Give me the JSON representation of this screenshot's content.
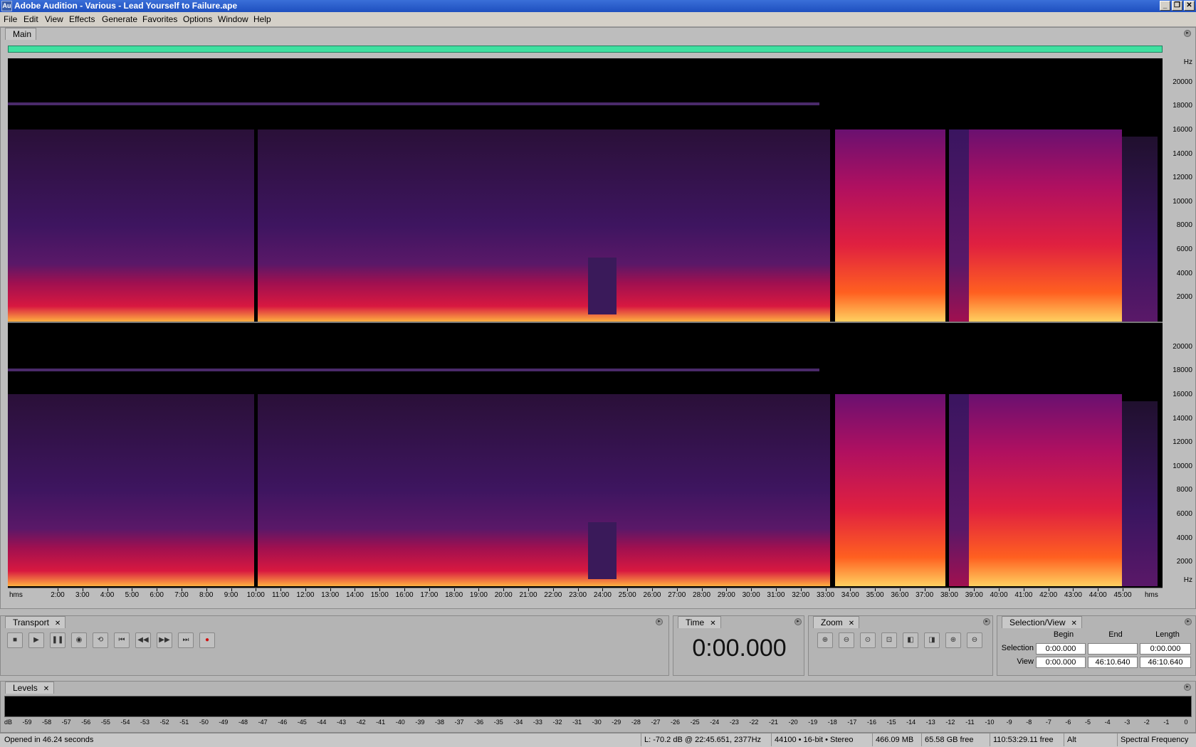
{
  "window": {
    "title": "Adobe Audition - Various - Lead Yourself to Failure.ape",
    "app_icon": "Au"
  },
  "menu": [
    "File",
    "Edit",
    "View",
    "Effects",
    "Generate",
    "Favorites",
    "Options",
    "Window",
    "Help"
  ],
  "main": {
    "tab": "Main",
    "hz_unit": "Hz",
    "hz_ticks": [
      "20000",
      "18000",
      "16000",
      "14000",
      "12000",
      "10000",
      "8000",
      "6000",
      "4000",
      "2000"
    ],
    "time_unit": "hms",
    "time_ticks": [
      "2:00",
      "3:00",
      "4:00",
      "5:00",
      "6:00",
      "7:00",
      "8:00",
      "9:00",
      "10:00",
      "11:00",
      "12:00",
      "13:00",
      "14:00",
      "15:00",
      "16:00",
      "17:00",
      "18:00",
      "19:00",
      "20:00",
      "21:00",
      "22:00",
      "23:00",
      "24:00",
      "25:00",
      "26:00",
      "27:00",
      "28:00",
      "29:00",
      "30:00",
      "31:00",
      "32:00",
      "33:00",
      "34:00",
      "35:00",
      "36:00",
      "37:00",
      "38:00",
      "39:00",
      "40:00",
      "41:00",
      "42:00",
      "43:00",
      "44:00",
      "45:00"
    ]
  },
  "transport": {
    "tab": "Transport",
    "buttons": [
      "stop-icon",
      "play-icon",
      "pause-icon",
      "play-from-cursor-icon",
      "loop-icon",
      "go-to-start-icon",
      "rewind-icon",
      "fast-forward-icon",
      "go-to-end-icon",
      "record-icon"
    ]
  },
  "time": {
    "tab": "Time",
    "value": "0:00.000"
  },
  "zoom": {
    "tab": "Zoom",
    "tools": [
      "zoom-in-horizontal-icon",
      "zoom-out-horizontal-icon",
      "zoom-full-icon",
      "zoom-selection-icon",
      "zoom-left-edge-icon",
      "zoom-right-edge-icon",
      "zoom-in-vertical-icon",
      "zoom-out-vertical-icon"
    ]
  },
  "selection_view": {
    "tab": "Selection/View",
    "headers": [
      "Begin",
      "End",
      "Length"
    ],
    "rows": [
      {
        "label": "Selection",
        "begin": "0:00.000",
        "end": "",
        "length": "0:00.000"
      },
      {
        "label": "View",
        "begin": "0:00.000",
        "end": "46:10.640",
        "length": "46:10.640"
      }
    ]
  },
  "levels": {
    "tab": "Levels",
    "unit": "dB",
    "ticks": [
      "-59",
      "-58",
      "-57",
      "-56",
      "-55",
      "-54",
      "-53",
      "-52",
      "-51",
      "-50",
      "-49",
      "-48",
      "-47",
      "-46",
      "-45",
      "-44",
      "-43",
      "-42",
      "-41",
      "-40",
      "-39",
      "-38",
      "-37",
      "-36",
      "-35",
      "-34",
      "-33",
      "-32",
      "-31",
      "-30",
      "-29",
      "-28",
      "-27",
      "-26",
      "-25",
      "-24",
      "-23",
      "-22",
      "-21",
      "-20",
      "-19",
      "-18",
      "-17",
      "-16",
      "-15",
      "-14",
      "-13",
      "-12",
      "-11",
      "-10",
      "-9",
      "-8",
      "-7",
      "-6",
      "-5",
      "-4",
      "-3",
      "-2",
      "-1",
      "0"
    ]
  },
  "status": {
    "message": "Opened in 46.24 seconds",
    "cursor": "L: -70.2 dB @  22:45.651, 2377Hz",
    "format": "44100 • 16-bit • Stereo",
    "size": "466.09 MB",
    "free": "65.58 GB free",
    "time_free": "110:53:29.11 free",
    "key": "Alt",
    "mode": "Spectral Frequency"
  },
  "colors": {
    "accent": "#40e0a0",
    "hot": "#ff6020",
    "warm": "#c0104a",
    "cool": "#3a1a5a"
  }
}
